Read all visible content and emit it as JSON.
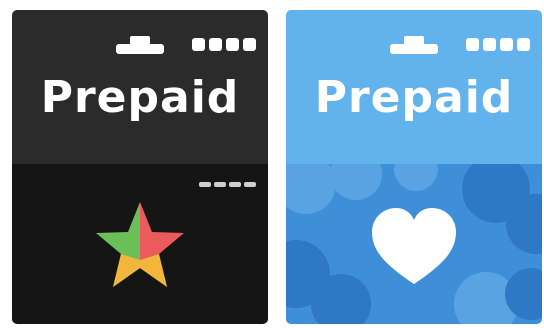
{
  "cards": [
    {
      "title": "Prepaid",
      "style": "dark",
      "emblem": "star-icon",
      "colors": {
        "top": "#2b2b2b",
        "bottom": "#151515",
        "text": "#ffffff",
        "star_green": "#6bbf59",
        "star_red": "#ec5b5b",
        "star_yellow": "#f3b63c"
      }
    },
    {
      "title": "Prepaid",
      "style": "blue",
      "emblem": "heart-icon",
      "colors": {
        "top": "#62b3ec",
        "bottom": "#3f8fd8",
        "cloud_light": "#5aa3e3",
        "cloud_dark": "#2f78c6",
        "text": "#ffffff",
        "heart": "#ffffff"
      }
    }
  ]
}
